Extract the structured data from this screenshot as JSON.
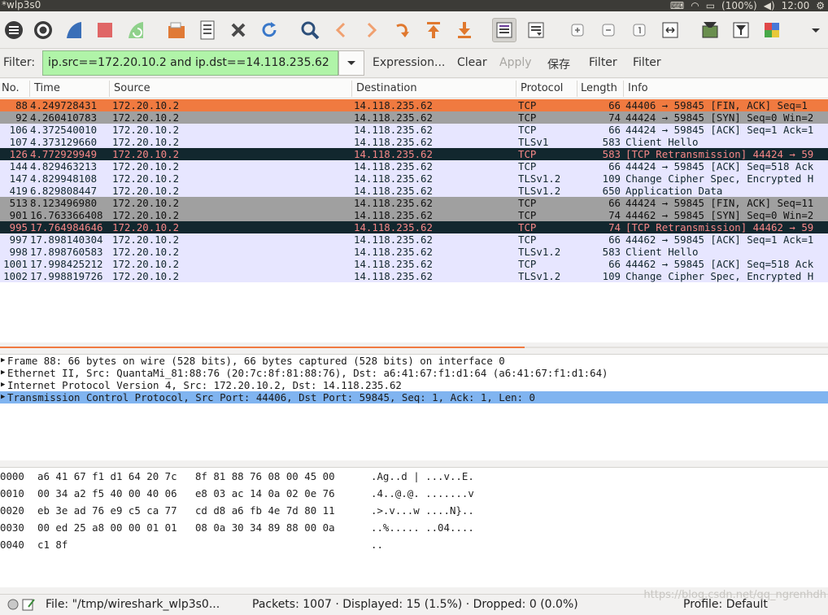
{
  "titlebar": {
    "title": "*wlp3s0",
    "battery": "(100%)",
    "clock": "12:00"
  },
  "toolbar": {
    "buttons": [
      {
        "icon": "interface-list-icon"
      },
      {
        "icon": "capture-options-icon"
      },
      {
        "icon": "start-capture-icon"
      },
      {
        "icon": "stop-capture-icon"
      },
      {
        "icon": "restart-capture-icon"
      },
      {
        "icon": "open-file-icon"
      },
      {
        "icon": "save-file-icon"
      },
      {
        "icon": "close-file-icon"
      },
      {
        "icon": "reload-icon"
      },
      {
        "icon": "find-packet-icon"
      },
      {
        "icon": "go-back-icon"
      },
      {
        "icon": "go-forward-icon"
      },
      {
        "icon": "go-to-packet-icon"
      },
      {
        "icon": "go-first-icon"
      },
      {
        "icon": "go-last-icon"
      },
      {
        "icon": "auto-scroll-icon"
      },
      {
        "icon": "colorize-icon"
      },
      {
        "icon": "zoom-in-icon"
      },
      {
        "icon": "zoom-out-icon"
      },
      {
        "icon": "normal-size-icon"
      },
      {
        "icon": "resize-columns-icon"
      },
      {
        "icon": "capture-filters-icon"
      },
      {
        "icon": "display-filters-icon"
      },
      {
        "icon": "coloring-rules-icon"
      },
      {
        "icon": "more-icon"
      }
    ]
  },
  "filterbar": {
    "label": "Filter:",
    "value": "ip.src==172.20.10.2 and ip.dst==14.118.235.62",
    "expression": "Expression...",
    "clear": "Clear",
    "apply": "Apply",
    "save": "保存",
    "filter1": "Filter",
    "filter2": "Filter"
  },
  "packet_list": {
    "columns": [
      "No.",
      "Time",
      "Source",
      "Destination",
      "Protocol",
      "Length",
      "Info"
    ],
    "rows": [
      {
        "no": "88",
        "time": "4.249728431",
        "src": "172.20.10.2",
        "dst": "14.118.235.62",
        "proto": "TCP",
        "len": "66",
        "info": "44406 → 59845 [FIN, ACK] Seq=1",
        "style": "orange"
      },
      {
        "no": "92",
        "time": "4.260410783",
        "src": "172.20.10.2",
        "dst": "14.118.235.62",
        "proto": "TCP",
        "len": "74",
        "info": "44424 → 59845 [SYN] Seq=0 Win=2",
        "style": "gray"
      },
      {
        "no": "106",
        "time": "4.372540010",
        "src": "172.20.10.2",
        "dst": "14.118.235.62",
        "proto": "TCP",
        "len": "66",
        "info": "44424 → 59845 [ACK] Seq=1 Ack=1",
        "style": "lav"
      },
      {
        "no": "107",
        "time": "4.373129660",
        "src": "172.20.10.2",
        "dst": "14.118.235.62",
        "proto": "TLSv1",
        "len": "583",
        "info": "Client Hello",
        "style": "lav"
      },
      {
        "no": "126",
        "time": "4.772929949",
        "src": "172.20.10.2",
        "dst": "14.118.235.62",
        "proto": "TCP",
        "len": "583",
        "info": "[TCP Retransmission] 44424 → 59",
        "style": "dark"
      },
      {
        "no": "144",
        "time": "4.829463213",
        "src": "172.20.10.2",
        "dst": "14.118.235.62",
        "proto": "TCP",
        "len": "66",
        "info": "44424 → 59845 [ACK] Seq=518 Ack",
        "style": "lav"
      },
      {
        "no": "147",
        "time": "4.829948108",
        "src": "172.20.10.2",
        "dst": "14.118.235.62",
        "proto": "TLSv1.2",
        "len": "109",
        "info": "Change Cipher Spec, Encrypted H",
        "style": "lav"
      },
      {
        "no": "419",
        "time": "6.829808447",
        "src": "172.20.10.2",
        "dst": "14.118.235.62",
        "proto": "TLSv1.2",
        "len": "650",
        "info": "Application Data",
        "style": "lav"
      },
      {
        "no": "513",
        "time": "8.123496980",
        "src": "172.20.10.2",
        "dst": "14.118.235.62",
        "proto": "TCP",
        "len": "66",
        "info": "44424 → 59845 [FIN, ACK] Seq=11",
        "style": "gray"
      },
      {
        "no": "901",
        "time": "16.763366408",
        "src": "172.20.10.2",
        "dst": "14.118.235.62",
        "proto": "TCP",
        "len": "74",
        "info": "44462 → 59845 [SYN] Seq=0 Win=2",
        "style": "gray"
      },
      {
        "no": "995",
        "time": "17.764984646",
        "src": "172.20.10.2",
        "dst": "14.118.235.62",
        "proto": "TCP",
        "len": "74",
        "info": "[TCP Retransmission] 44462 → 59",
        "style": "dark"
      },
      {
        "no": "997",
        "time": "17.898140304",
        "src": "172.20.10.2",
        "dst": "14.118.235.62",
        "proto": "TCP",
        "len": "66",
        "info": "44462 → 59845 [ACK] Seq=1 Ack=1",
        "style": "lav"
      },
      {
        "no": "998",
        "time": "17.898760583",
        "src": "172.20.10.2",
        "dst": "14.118.235.62",
        "proto": "TLSv1.2",
        "len": "583",
        "info": "Client Hello",
        "style": "lav"
      },
      {
        "no": "1001",
        "time": "17.998425212",
        "src": "172.20.10.2",
        "dst": "14.118.235.62",
        "proto": "TCP",
        "len": "66",
        "info": "44462 → 59845 [ACK] Seq=518 Ack",
        "style": "lav"
      },
      {
        "no": "1002",
        "time": "17.998819726",
        "src": "172.20.10.2",
        "dst": "14.118.235.62",
        "proto": "TLSv1.2",
        "len": "109",
        "info": "Change Cipher Spec, Encrypted H",
        "style": "lav"
      }
    ]
  },
  "details": [
    {
      "text": "Frame 88: 66 bytes on wire (528 bits), 66 bytes captured (528 bits) on interface 0",
      "selected": false
    },
    {
      "text": "Ethernet II, Src: QuantaMi_81:88:76 (20:7c:8f:81:88:76), Dst: a6:41:67:f1:d1:64 (a6:41:67:f1:d1:64)",
      "selected": false
    },
    {
      "text": "Internet Protocol Version 4, Src: 172.20.10.2, Dst: 14.118.235.62",
      "selected": false
    },
    {
      "text": "Transmission Control Protocol, Src Port: 44406, Dst Port: 59845, Seq: 1, Ack: 1, Len: 0",
      "selected": true
    }
  ],
  "bytes": [
    {
      "offset": "0000",
      "hex": "a6 41 67 f1 d1 64 20 7c   8f 81 88 76 08 00 45 00",
      "ascii": ".Ag..d | ...v..E."
    },
    {
      "offset": "0010",
      "hex": "00 34 a2 f5 40 00 40 06   e8 03 ac 14 0a 02 0e 76",
      "ascii": ".4..@.@. .......v"
    },
    {
      "offset": "0020",
      "hex": "eb 3e ad 76 e9 c5 ca 77   cd d8 a6 fb 4e 7d 80 11",
      "ascii": ".>.v...w ....N}.."
    },
    {
      "offset": "0030",
      "hex": "00 ed 25 a8 00 00 01 01   08 0a 30 34 89 88 00 0a",
      "ascii": "..%..... ..04...."
    },
    {
      "offset": "0040",
      "hex": "c1 8f",
      "ascii": ".."
    }
  ],
  "statusbar": {
    "file": "File: \"/tmp/wireshark_wlp3s0...",
    "counts": "Packets: 1007 · Displayed: 15 (1.5%) · Dropped: 0 (0.0%)",
    "profile": "Profile: Default",
    "watermark": "https://blog.csdn.net/qq_ngrenhdh"
  },
  "colors": {
    "orange_row": "#f07a40",
    "gray_row": "#a0a0a0",
    "lavender_row": "#e7e6ff",
    "dark_row": "#12272e",
    "filter_valid": "#b0f4a8",
    "selection": "#80b4f0"
  }
}
